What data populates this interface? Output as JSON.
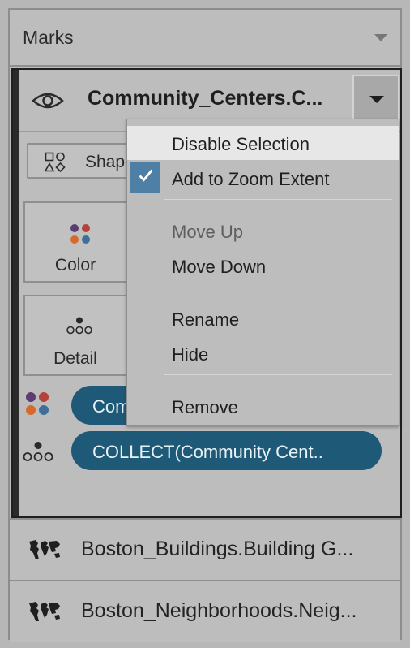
{
  "marks_panel": {
    "title": "Marks"
  },
  "active_layer": {
    "title": "Community_Centers.C...",
    "shape_button_label": "Shape",
    "cards": [
      {
        "label": "Color"
      },
      {
        "label": "Detail"
      }
    ],
    "pills": [
      {
        "label": "Com"
      },
      {
        "label": "COLLECT(Community Cent.."
      }
    ]
  },
  "context_menu": {
    "items": [
      {
        "label": "Disable Selection",
        "state": "highlighted"
      },
      {
        "label": "Add to Zoom Extent",
        "checked": true
      },
      {
        "label": "Move Up",
        "enabled": false
      },
      {
        "label": "Move Down"
      },
      {
        "label": "Rename"
      },
      {
        "label": "Hide"
      },
      {
        "label": "Remove"
      }
    ]
  },
  "other_layers": [
    {
      "label": "Boston_Buildings.Building G..."
    },
    {
      "label": "Boston_Neighborhoods.Neig..."
    }
  ],
  "colors": {
    "panel_bg": "#bdbdbd",
    "pill_bg": "#1e5a78",
    "check_bg": "#4e80a6",
    "dot_purple": "#5c3d73",
    "dot_red": "#b5413a",
    "dot_orange": "#d66a2c",
    "dot_blue": "#3f6f96"
  }
}
